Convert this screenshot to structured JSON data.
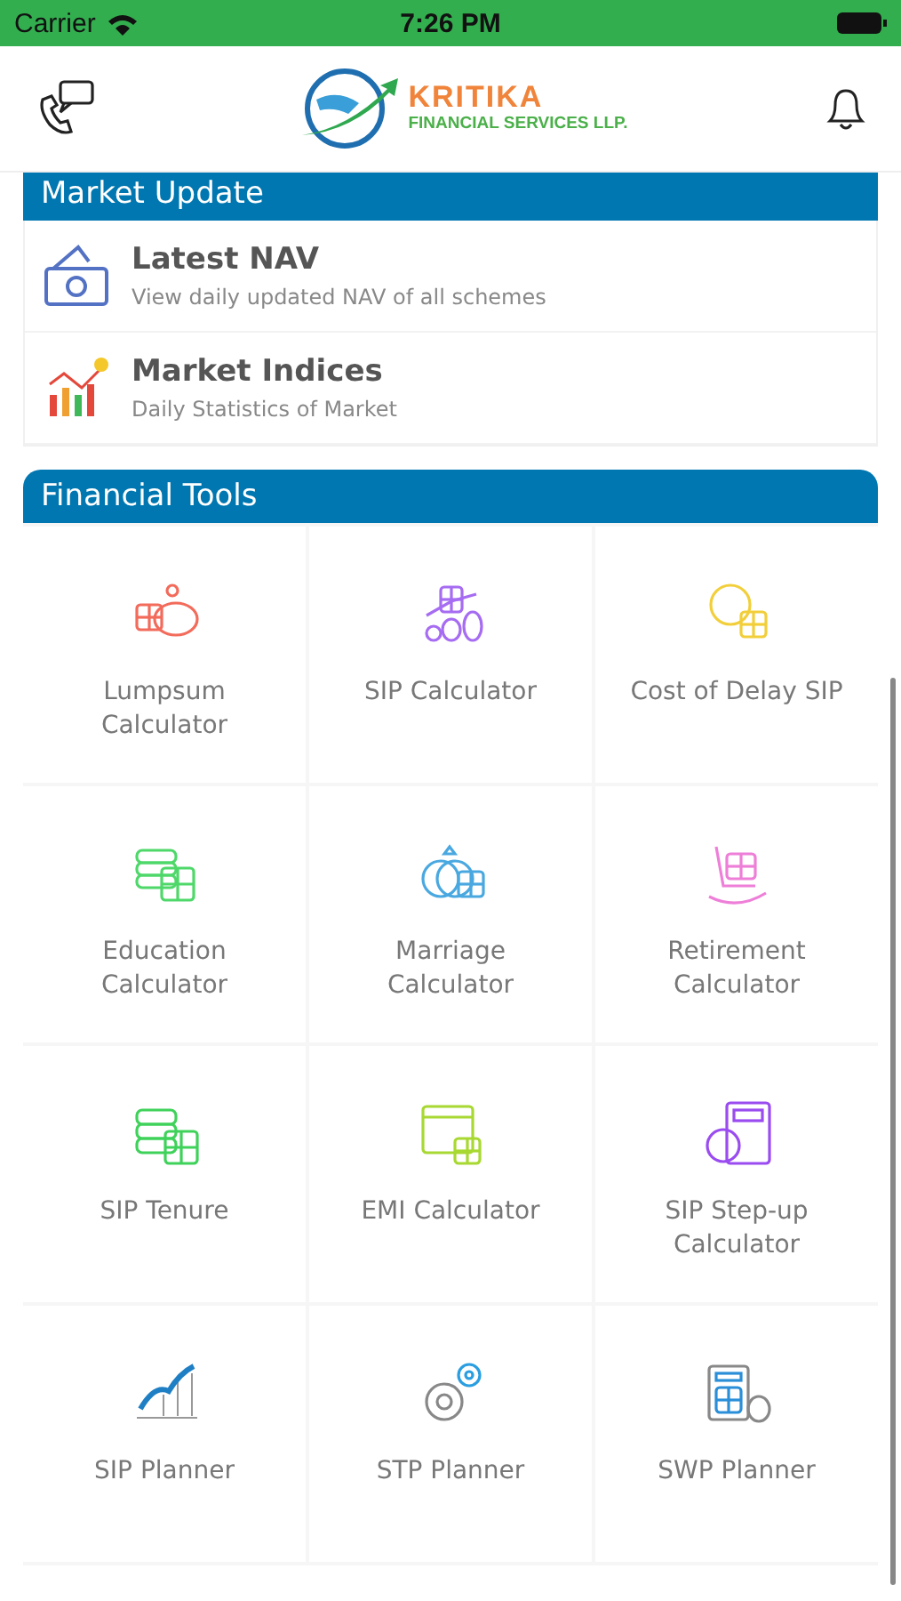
{
  "status_bar": {
    "carrier": "Carrier",
    "time": "7:26 PM"
  },
  "header": {
    "brand_name": "KRITIKA",
    "brand_tagline": "FINANCIAL SERVICES LLP."
  },
  "market_update": {
    "title": "Market Update",
    "items": [
      {
        "title": "Latest NAV",
        "subtitle": "View daily updated NAV of all schemes"
      },
      {
        "title": "Market Indices",
        "subtitle": "Daily Statistics of Market"
      }
    ]
  },
  "financial_tools": {
    "title": "Financial Tools",
    "items": [
      {
        "label": "Lumpsum Calculator",
        "color": "#f26b5b"
      },
      {
        "label": "SIP Calculator",
        "color": "#a66cf2"
      },
      {
        "label": "Cost of Delay SIP",
        "color": "#f2cf3a"
      },
      {
        "label": "Education Calculator",
        "color": "#4fd86a"
      },
      {
        "label": "Marriage Calculator",
        "color": "#4aa8e0"
      },
      {
        "label": "Retirement Calculator",
        "color": "#ee7fd8"
      },
      {
        "label": "SIP Tenure",
        "color": "#3fd25a"
      },
      {
        "label": "EMI Calculator",
        "color": "#a8d832"
      },
      {
        "label": "SIP Step-up Calculator",
        "color": "#9a4cf0"
      },
      {
        "label": "SIP Planner",
        "color": "#1f7fc4"
      },
      {
        "label": "STP Planner",
        "color": "#2a9ee0"
      },
      {
        "label": "SWP Planner",
        "color": "#2a8fd8"
      }
    ]
  }
}
